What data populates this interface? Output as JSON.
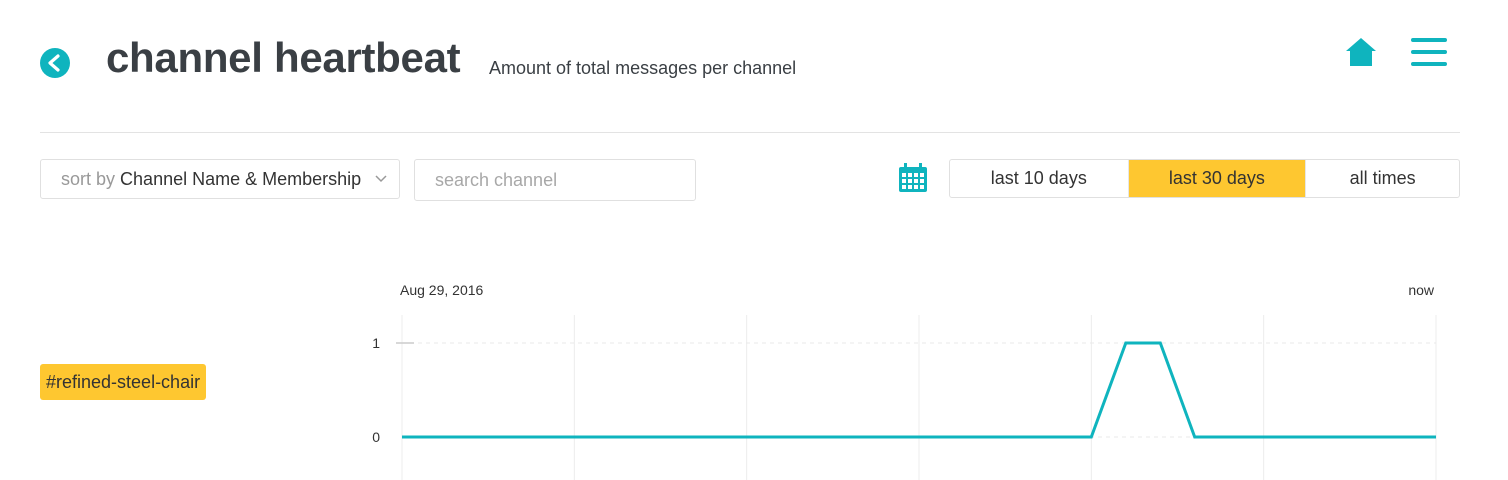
{
  "header": {
    "title": "channel heartbeat",
    "subtitle": "Amount of total messages per channel",
    "back_icon": "back-arrow-icon",
    "home_icon": "home-icon",
    "menu_icon": "hamburger-menu-icon",
    "accent_color": "#0fb4be"
  },
  "toolbar": {
    "sort_prefix": "sort by",
    "sort_value": "Channel Name & Membership",
    "search_placeholder": "search channel",
    "search_value": "",
    "calendar_icon": "calendar-icon",
    "ranges": [
      {
        "label": "last 10 days",
        "active": false
      },
      {
        "label": "last 30 days",
        "active": true
      },
      {
        "label": "all times",
        "active": false
      }
    ],
    "active_color": "#fec730"
  },
  "channels": [
    {
      "name": "#refined-steel-chair"
    }
  ],
  "chart_data": {
    "type": "line",
    "x_start_label": "Aug 29, 2016",
    "x_end_label": "now",
    "ylim": [
      0,
      1
    ],
    "yticks": [
      0,
      1
    ],
    "grid": true,
    "series": [
      {
        "line_color": "#0fb4be",
        "points": [
          [
            0,
            0
          ],
          [
            20,
            0
          ],
          [
            21,
            1
          ],
          [
            22,
            1
          ],
          [
            23,
            0
          ],
          [
            30,
            0
          ]
        ]
      }
    ]
  }
}
